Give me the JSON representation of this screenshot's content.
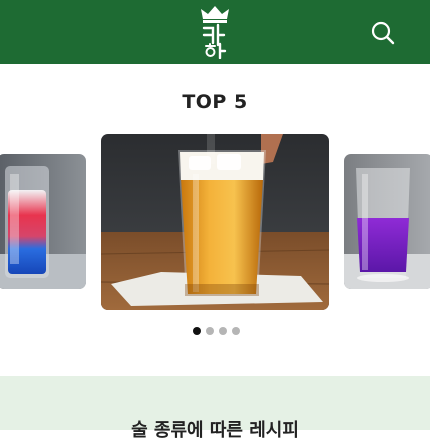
{
  "header": {
    "logo_text": "키하",
    "logo_icon": "crown-icon",
    "search_icon": "search-icon",
    "background_color": "#1e6b33"
  },
  "top_section": {
    "title": "TOP 5",
    "slides": [
      {
        "name": "red-blue-layered-cocktail"
      },
      {
        "name": "beer-glass"
      },
      {
        "name": "purple-cocktail"
      }
    ],
    "pagination": {
      "total": 4,
      "active": 1
    }
  },
  "category_section": {
    "title": "술 종류에 따른 레시피",
    "background_color": "#e5f1e5"
  }
}
